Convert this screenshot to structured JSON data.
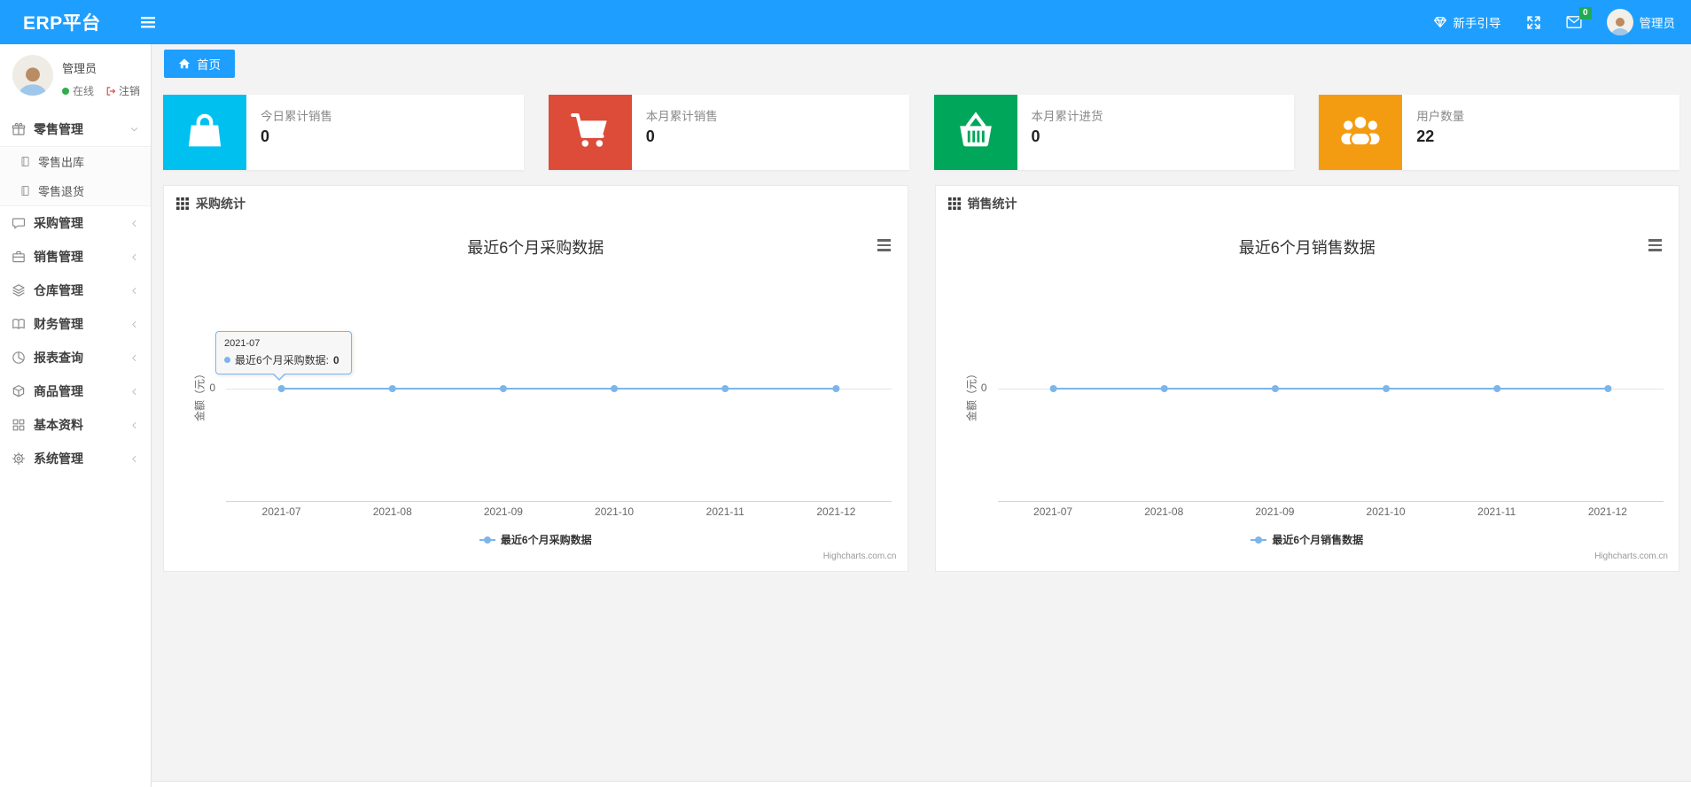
{
  "colors": {
    "navbar_bg": "#1e9fff",
    "badge_green": "#1faa53",
    "online_green": "#2fae49",
    "logout_red": "#d9534f",
    "chart_line": "#7cb5ec"
  },
  "navbar": {
    "brand": "ERP平台",
    "guide_label": "新手引导",
    "message_count": "0",
    "user": "管理员"
  },
  "sidebar": {
    "profile": {
      "name": "管理员",
      "status": "在线",
      "logout": "注销"
    },
    "menu": [
      {
        "key": "retail",
        "label": "零售管理",
        "icon": "gift-icon",
        "expanded": true,
        "children": [
          {
            "key": "retail-outbound",
            "label": "零售出库",
            "icon": "file-icon"
          },
          {
            "key": "retail-return",
            "label": "零售退货",
            "icon": "file-icon"
          }
        ]
      },
      {
        "key": "purchase",
        "label": "采购管理",
        "icon": "comment-icon"
      },
      {
        "key": "sales",
        "label": "销售管理",
        "icon": "briefcase-icon"
      },
      {
        "key": "warehouse",
        "label": "仓库管理",
        "icon": "layers-icon"
      },
      {
        "key": "finance",
        "label": "财务管理",
        "icon": "book-icon"
      },
      {
        "key": "reports",
        "label": "报表查询",
        "icon": "pie-chart-icon"
      },
      {
        "key": "goods",
        "label": "商品管理",
        "icon": "box-icon"
      },
      {
        "key": "basic-data",
        "label": "基本资料",
        "icon": "grid-icon"
      },
      {
        "key": "system",
        "label": "系统管理",
        "icon": "gear-icon"
      }
    ]
  },
  "breadcrumb": {
    "home": "首页",
    "icon": "home-icon"
  },
  "cards": [
    {
      "key": "today-sales",
      "title": "今日累计销售",
      "value": "0",
      "color": "#00c0ef",
      "icon": "shopping-bag-icon"
    },
    {
      "key": "month-sales",
      "title": "本月累计销售",
      "value": "0",
      "color": "#dd4b39",
      "icon": "shopping-cart-icon"
    },
    {
      "key": "month-purchase",
      "title": "本月累计进货",
      "value": "0",
      "color": "#00a65a",
      "icon": "shopping-basket-icon"
    },
    {
      "key": "user-count",
      "title": "用户数量",
      "value": "22",
      "color": "#f39c12",
      "icon": "users-icon"
    }
  ],
  "panels": [
    {
      "title": "采购统计"
    },
    {
      "title": "销售统计"
    }
  ],
  "chart_data": [
    {
      "type": "line",
      "title": "最近6个月采购数据",
      "categories": [
        "2021-07",
        "2021-08",
        "2021-09",
        "2021-10",
        "2021-11",
        "2021-12"
      ],
      "series": [
        {
          "name": "最近6个月采购数据",
          "values": [
            0,
            0,
            0,
            0,
            0,
            0
          ],
          "color": "#7cb5ec"
        }
      ],
      "ylabel": "金额（元）",
      "yticks": [
        "0"
      ],
      "grid": true,
      "legend_position": "bottom",
      "credits": "Highcharts.com.cn",
      "tooltip": {
        "header": "2021-07",
        "label": "最近6个月采购数据",
        "value": "0"
      }
    },
    {
      "type": "line",
      "title": "最近6个月销售数据",
      "categories": [
        "2021-07",
        "2021-08",
        "2021-09",
        "2021-10",
        "2021-11",
        "2021-12"
      ],
      "series": [
        {
          "name": "最近6个月销售数据",
          "values": [
            0,
            0,
            0,
            0,
            0,
            0
          ],
          "color": "#7cb5ec"
        }
      ],
      "ylabel": "金额（元）",
      "yticks": [
        "0"
      ],
      "grid": true,
      "legend_position": "bottom",
      "credits": "Highcharts.com.cn"
    }
  ]
}
